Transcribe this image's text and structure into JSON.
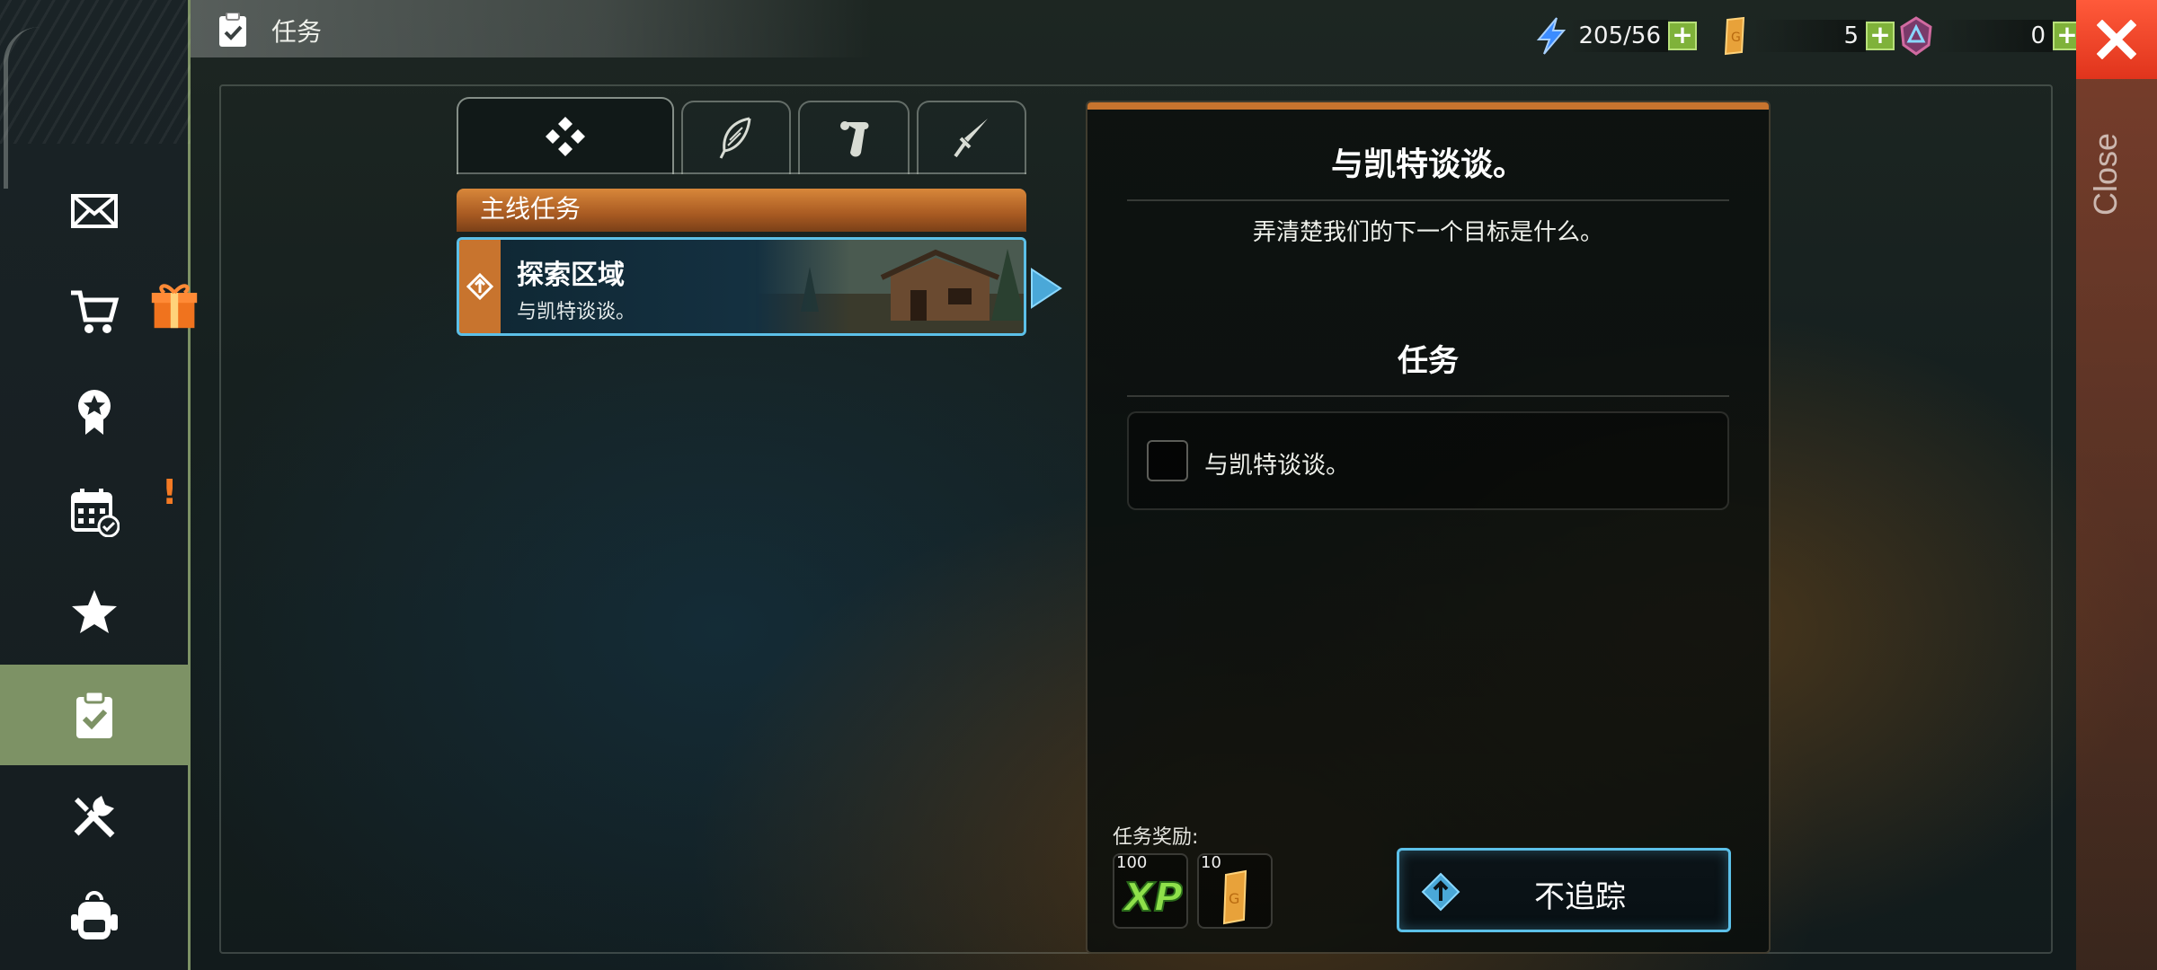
{
  "header": {
    "title": "任务"
  },
  "currencies": [
    {
      "name": "energy",
      "value": "205/56",
      "color": "#3b8cff"
    },
    {
      "name": "gold-bar",
      "value": "5",
      "color": "#e8a23a"
    },
    {
      "name": "gem",
      "value": "0",
      "color": "#c84a8a"
    }
  ],
  "close": {
    "label": "Close"
  },
  "sidebar": {
    "items": [
      {
        "icon": "mail-icon"
      },
      {
        "icon": "shop-cart-icon",
        "badge": "gift"
      },
      {
        "icon": "achievement-badge-icon"
      },
      {
        "icon": "calendar-icon",
        "badge": "!"
      },
      {
        "icon": "star-icon"
      },
      {
        "icon": "quest-clipboard-icon",
        "active": true
      },
      {
        "icon": "crafting-tools-icon"
      },
      {
        "icon": "backpack-icon"
      }
    ]
  },
  "tabs": [
    {
      "icon": "diamond-cluster-icon",
      "active": true
    },
    {
      "icon": "feather-icon"
    },
    {
      "icon": "scroll-icon"
    },
    {
      "icon": "sword-icon"
    }
  ],
  "quest_list": {
    "category": "主线任务",
    "quests": [
      {
        "title": "探索区域",
        "subtitle": "与凯特谈谈。",
        "selected": true
      }
    ]
  },
  "detail": {
    "title": "与凯特谈谈。",
    "description": "弄清楚我们的下一个目标是什么。",
    "objectives_header": "任务",
    "objectives": [
      {
        "text": "与凯特谈谈。",
        "done": false
      }
    ],
    "rewards_label": "任务奖励:",
    "rewards": [
      {
        "type": "xp",
        "amount": "100"
      },
      {
        "type": "gold-bar",
        "amount": "10"
      }
    ],
    "track_button": "不追踪"
  },
  "colors": {
    "accent_orange": "#c8742e",
    "accent_cyan": "#5cc0e8",
    "sidebar_active": "#7d9265",
    "close_red": "#f04428"
  }
}
